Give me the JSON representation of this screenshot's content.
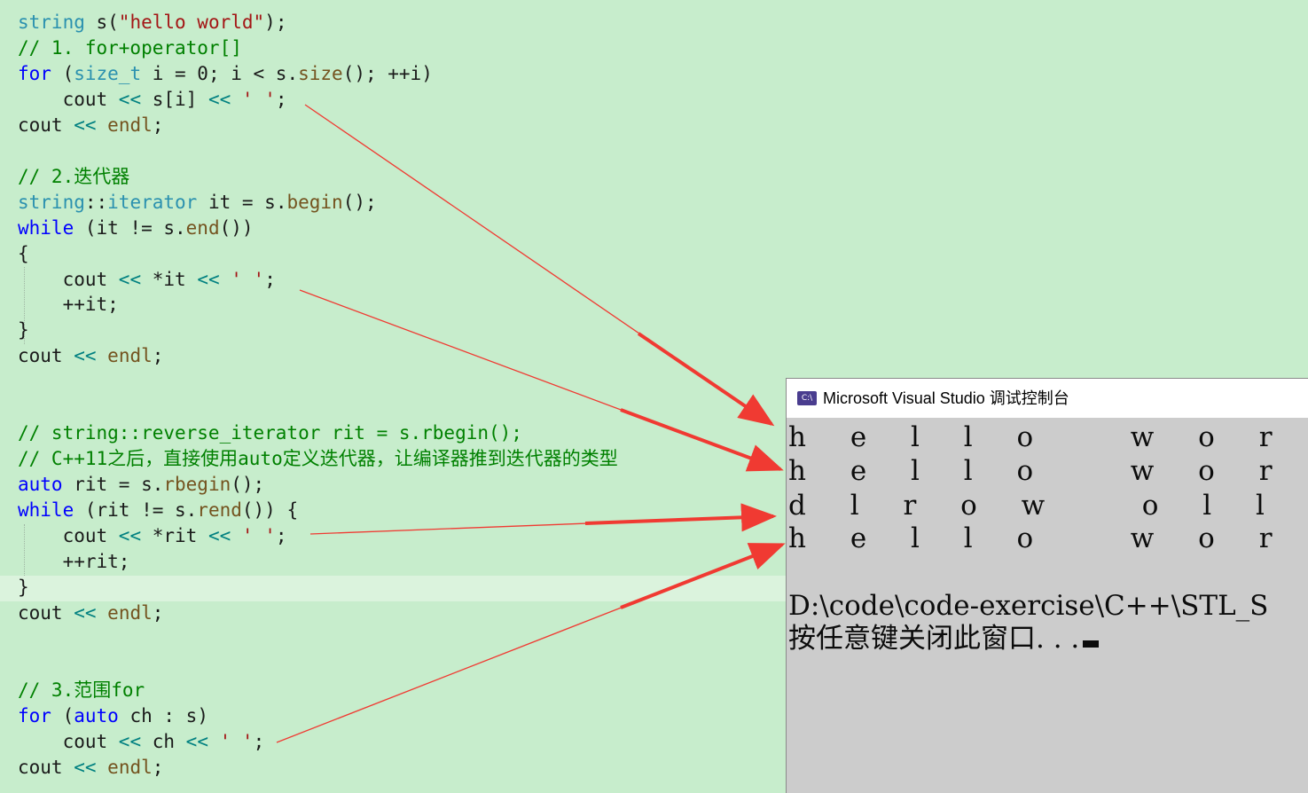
{
  "editor": {
    "lines": [
      [
        {
          "t": "string",
          "c": "t-type"
        },
        {
          "t": " s(",
          "c": "t-plain"
        },
        {
          "t": "\"hello world\"",
          "c": "t-str"
        },
        {
          "t": ");",
          "c": "t-plain"
        }
      ],
      [
        {
          "t": "// 1. for+operator[]",
          "c": "t-com"
        }
      ],
      [
        {
          "t": "for",
          "c": "t-kw"
        },
        {
          "t": " (",
          "c": "t-plain"
        },
        {
          "t": "size_t",
          "c": "t-type"
        },
        {
          "t": " i = 0; i < s.",
          "c": "t-plain"
        },
        {
          "t": "size",
          "c": "t-func"
        },
        {
          "t": "(); ++i)",
          "c": "t-plain"
        }
      ],
      [
        {
          "t": "    cout ",
          "c": "t-plain"
        },
        {
          "t": "<<",
          "c": "t-op"
        },
        {
          "t": " s[i] ",
          "c": "t-plain"
        },
        {
          "t": "<<",
          "c": "t-op"
        },
        {
          "t": " ",
          "c": "t-plain"
        },
        {
          "t": "' '",
          "c": "t-str"
        },
        {
          "t": ";",
          "c": "t-plain"
        }
      ],
      [
        {
          "t": "cout ",
          "c": "t-plain"
        },
        {
          "t": "<<",
          "c": "t-op"
        },
        {
          "t": " ",
          "c": "t-plain"
        },
        {
          "t": "endl",
          "c": "t-func"
        },
        {
          "t": ";",
          "c": "t-plain"
        }
      ],
      [],
      [
        {
          "t": "// 2.迭代器",
          "c": "t-com"
        }
      ],
      [
        {
          "t": "string",
          "c": "t-type"
        },
        {
          "t": "::",
          "c": "t-plain"
        },
        {
          "t": "iterator",
          "c": "t-type"
        },
        {
          "t": " it = s.",
          "c": "t-plain"
        },
        {
          "t": "begin",
          "c": "t-func"
        },
        {
          "t": "();",
          "c": "t-plain"
        }
      ],
      [
        {
          "t": "while",
          "c": "t-kw"
        },
        {
          "t": " (it != s.",
          "c": "t-plain"
        },
        {
          "t": "end",
          "c": "t-func"
        },
        {
          "t": "())",
          "c": "t-plain"
        }
      ],
      [
        {
          "t": "{",
          "c": "t-plain"
        }
      ],
      [
        {
          "t": "    cout ",
          "c": "t-plain"
        },
        {
          "t": "<<",
          "c": "t-op"
        },
        {
          "t": " *it ",
          "c": "t-plain"
        },
        {
          "t": "<<",
          "c": "t-op"
        },
        {
          "t": " ",
          "c": "t-plain"
        },
        {
          "t": "' '",
          "c": "t-str"
        },
        {
          "t": ";",
          "c": "t-plain"
        }
      ],
      [
        {
          "t": "    ++it;",
          "c": "t-plain"
        }
      ],
      [
        {
          "t": "}",
          "c": "t-plain"
        }
      ],
      [
        {
          "t": "cout ",
          "c": "t-plain"
        },
        {
          "t": "<<",
          "c": "t-op"
        },
        {
          "t": " ",
          "c": "t-plain"
        },
        {
          "t": "endl",
          "c": "t-func"
        },
        {
          "t": ";",
          "c": "t-plain"
        }
      ],
      [],
      [],
      [
        {
          "t": "// string::reverse_iterator rit = s.rbegin();",
          "c": "t-com"
        }
      ],
      [
        {
          "t": "// C++11之后，直接使用auto定义迭代器，让编译器推到迭代器的类型",
          "c": "t-com"
        }
      ],
      [
        {
          "t": "auto",
          "c": "t-kw"
        },
        {
          "t": " rit = s.",
          "c": "t-plain"
        },
        {
          "t": "rbegin",
          "c": "t-func"
        },
        {
          "t": "();",
          "c": "t-plain"
        }
      ],
      [
        {
          "t": "while",
          "c": "t-kw"
        },
        {
          "t": " (rit != s.",
          "c": "t-plain"
        },
        {
          "t": "rend",
          "c": "t-func"
        },
        {
          "t": "()) {",
          "c": "t-plain"
        }
      ],
      [
        {
          "t": "    cout ",
          "c": "t-plain"
        },
        {
          "t": "<<",
          "c": "t-op"
        },
        {
          "t": " *rit ",
          "c": "t-plain"
        },
        {
          "t": "<<",
          "c": "t-op"
        },
        {
          "t": " ",
          "c": "t-plain"
        },
        {
          "t": "' '",
          "c": "t-str"
        },
        {
          "t": ";",
          "c": "t-plain"
        }
      ],
      [
        {
          "t": "    ++rit;",
          "c": "t-plain"
        }
      ],
      [
        {
          "t": "}",
          "c": "t-plain"
        }
      ],
      [
        {
          "t": "cout ",
          "c": "t-plain"
        },
        {
          "t": "<<",
          "c": "t-op"
        },
        {
          "t": " ",
          "c": "t-plain"
        },
        {
          "t": "endl",
          "c": "t-func"
        },
        {
          "t": ";",
          "c": "t-plain"
        }
      ],
      [],
      [],
      [
        {
          "t": "// 3.范围for",
          "c": "t-com"
        }
      ],
      [
        {
          "t": "for",
          "c": "t-kw"
        },
        {
          "t": " (",
          "c": "t-plain"
        },
        {
          "t": "auto",
          "c": "t-kw"
        },
        {
          "t": " ch : s)",
          "c": "t-plain"
        }
      ],
      [
        {
          "t": "    cout ",
          "c": "t-plain"
        },
        {
          "t": "<<",
          "c": "t-op"
        },
        {
          "t": " ch ",
          "c": "t-plain"
        },
        {
          "t": "<<",
          "c": "t-op"
        },
        {
          "t": " ",
          "c": "t-plain"
        },
        {
          "t": "' '",
          "c": "t-str"
        },
        {
          "t": ";",
          "c": "t-plain"
        }
      ],
      [
        {
          "t": "cout ",
          "c": "t-plain"
        },
        {
          "t": "<<",
          "c": "t-op"
        },
        {
          "t": " ",
          "c": "t-plain"
        },
        {
          "t": "endl",
          "c": "t-func"
        },
        {
          "t": ";",
          "c": "t-plain"
        }
      ]
    ]
  },
  "console": {
    "icon_label": "C:\\",
    "title": "Microsoft Visual Studio 调试控制台",
    "output": [
      "h e l l o   w o r l d",
      "h e l l o   w o r l d",
      "d l r o w   o l l e h",
      "h e l l o   w o r l d"
    ],
    "path_line": "D:\\code\\code-exercise\\C++\\STL_S",
    "prompt_line": "按任意键关闭此窗口. . ."
  },
  "colors": {
    "editor_bg": "#c7edcc",
    "arrow": "#f03a32"
  }
}
